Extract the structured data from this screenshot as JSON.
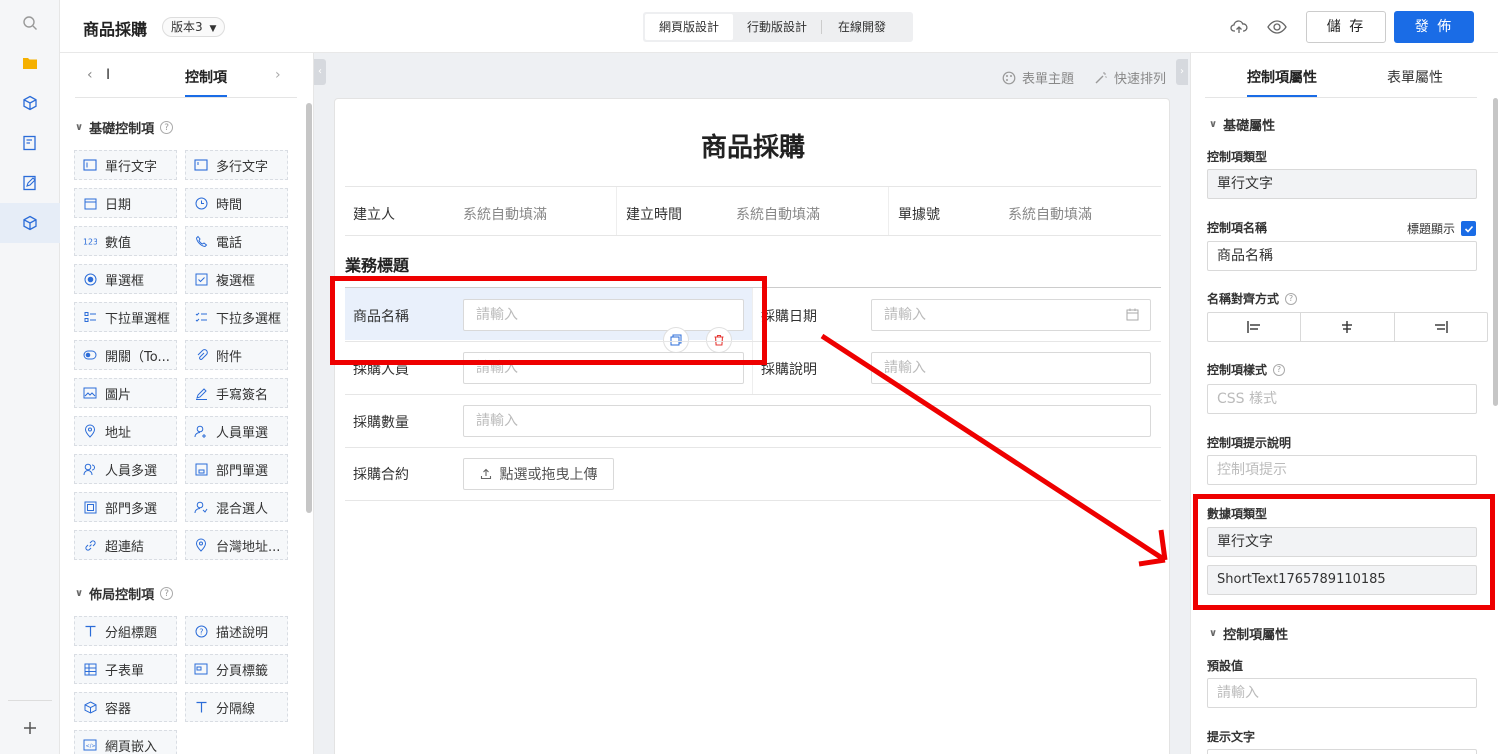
{
  "header": {
    "title": "商品採購",
    "version": "版本3",
    "mode_tabs": [
      "網頁版設計",
      "行動版設計",
      "在線開發"
    ],
    "save_label": "儲 存",
    "publish_label": "發 佈"
  },
  "left_panel": {
    "tab_partial": "I",
    "tab_active": "控制項",
    "group_basic": "基礎控制項",
    "basic_controls": [
      "單行文字",
      "多行文字",
      "日期",
      "時間",
      "數值",
      "電話",
      "單選框",
      "複選框",
      "下拉單選框",
      "下拉多選框",
      "開關（To...",
      "附件",
      "圖片",
      "手寫簽名",
      "地址",
      "人員單選",
      "人員多選",
      "部門單選",
      "部門多選",
      "混合選人",
      "超連結",
      "台灣地址..."
    ],
    "group_layout": "佈局控制項",
    "layout_controls": [
      "分組標題",
      "描述說明",
      "子表單",
      "分頁標籤",
      "容器",
      "分隔線",
      "網頁嵌入"
    ]
  },
  "canvas": {
    "tool_theme": "表單主題",
    "tool_arrange": "快速排列",
    "form_title": "商品採購",
    "meta": [
      {
        "label": "建立人",
        "value": "系統自動填滿"
      },
      {
        "label": "建立時間",
        "value": "系統自動填滿"
      },
      {
        "label": "單據號",
        "value": "系統自動填滿"
      }
    ],
    "section_title": "業務標題",
    "fields": {
      "name_label": "商品名稱",
      "date_label": "採購日期",
      "person_label": "採購人員",
      "desc_label": "採購說明",
      "qty_label": "採購數量",
      "contract_label": "採購合約",
      "placeholder": "請輸入",
      "upload_label": "點選或拖曳上傳"
    }
  },
  "right_panel": {
    "tab_active": "控制項屬性",
    "tab_other": "表單屬性",
    "sect_basic": "基礎屬性",
    "type_label": "控制項類型",
    "type_value": "單行文字",
    "name_label": "控制項名稱",
    "show_title_label": "標題顯示",
    "name_value": "商品名稱",
    "align_label": "名稱對齊方式",
    "style_label": "控制項樣式",
    "style_placeholder": "CSS 樣式",
    "hint_label": "控制項提示說明",
    "hint_placeholder": "控制項提示",
    "data_type_label": "數據項類型",
    "data_type_value": "單行文字",
    "data_id_value": "ShortText1765789110185",
    "sect_ctrl": "控制項屬性",
    "default_label": "預設值",
    "default_placeholder": "請輸入",
    "tip_label": "提示文字"
  },
  "colors": {
    "accent": "#1a6ce6",
    "annotation": "#ee0000"
  }
}
